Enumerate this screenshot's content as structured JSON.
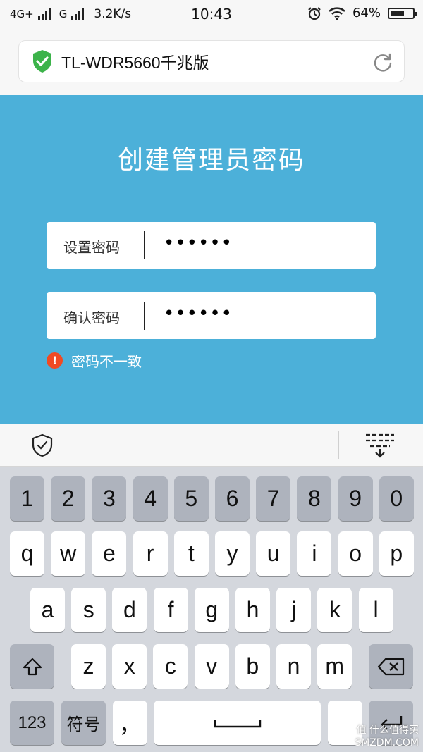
{
  "status_bar": {
    "network1": "4G+",
    "network2": "G",
    "speed": "3.2K/s",
    "time": "10:43",
    "battery_text": "64%",
    "battery_level": 0.64,
    "icons": [
      "alarm-icon",
      "wifi-icon",
      "battery-icon"
    ]
  },
  "url_bar": {
    "title": "TL-WDR5660千兆版",
    "secure_icon": "shield-check-icon",
    "reload_icon": "reload-icon"
  },
  "form": {
    "heading": "创建管理员密码",
    "password_label": "设置密码",
    "password_value": "••••••",
    "confirm_label": "确认密码",
    "confirm_value": "••••••",
    "error_icon": "!",
    "error_text": "密码不一致"
  },
  "colors": {
    "panel_bg": "#4cb0d9",
    "error_red": "#f04a23",
    "shield_green": "#3cb34a"
  },
  "keyboard": {
    "toolbar_icons": [
      "keyboard-shield-icon",
      "hide-keyboard-icon"
    ],
    "row1": [
      "1",
      "2",
      "3",
      "4",
      "5",
      "6",
      "7",
      "8",
      "9",
      "0"
    ],
    "row2": [
      "q",
      "w",
      "e",
      "r",
      "t",
      "y",
      "u",
      "i",
      "o",
      "p"
    ],
    "row3": [
      "a",
      "s",
      "d",
      "f",
      "g",
      "h",
      "j",
      "k",
      "l"
    ],
    "row4": [
      "z",
      "x",
      "c",
      "v",
      "b",
      "n",
      "m"
    ],
    "shift_icon": "shift-icon",
    "delete_icon": "backspace-icon",
    "key_123": "123",
    "key_symbols": "符号",
    "key_comma": "，",
    "space_icon": "space-icon",
    "enter_icon": "enter-icon"
  },
  "watermark": {
    "line1": "值 什么值得买",
    "line2": "SMZDM.COM"
  }
}
